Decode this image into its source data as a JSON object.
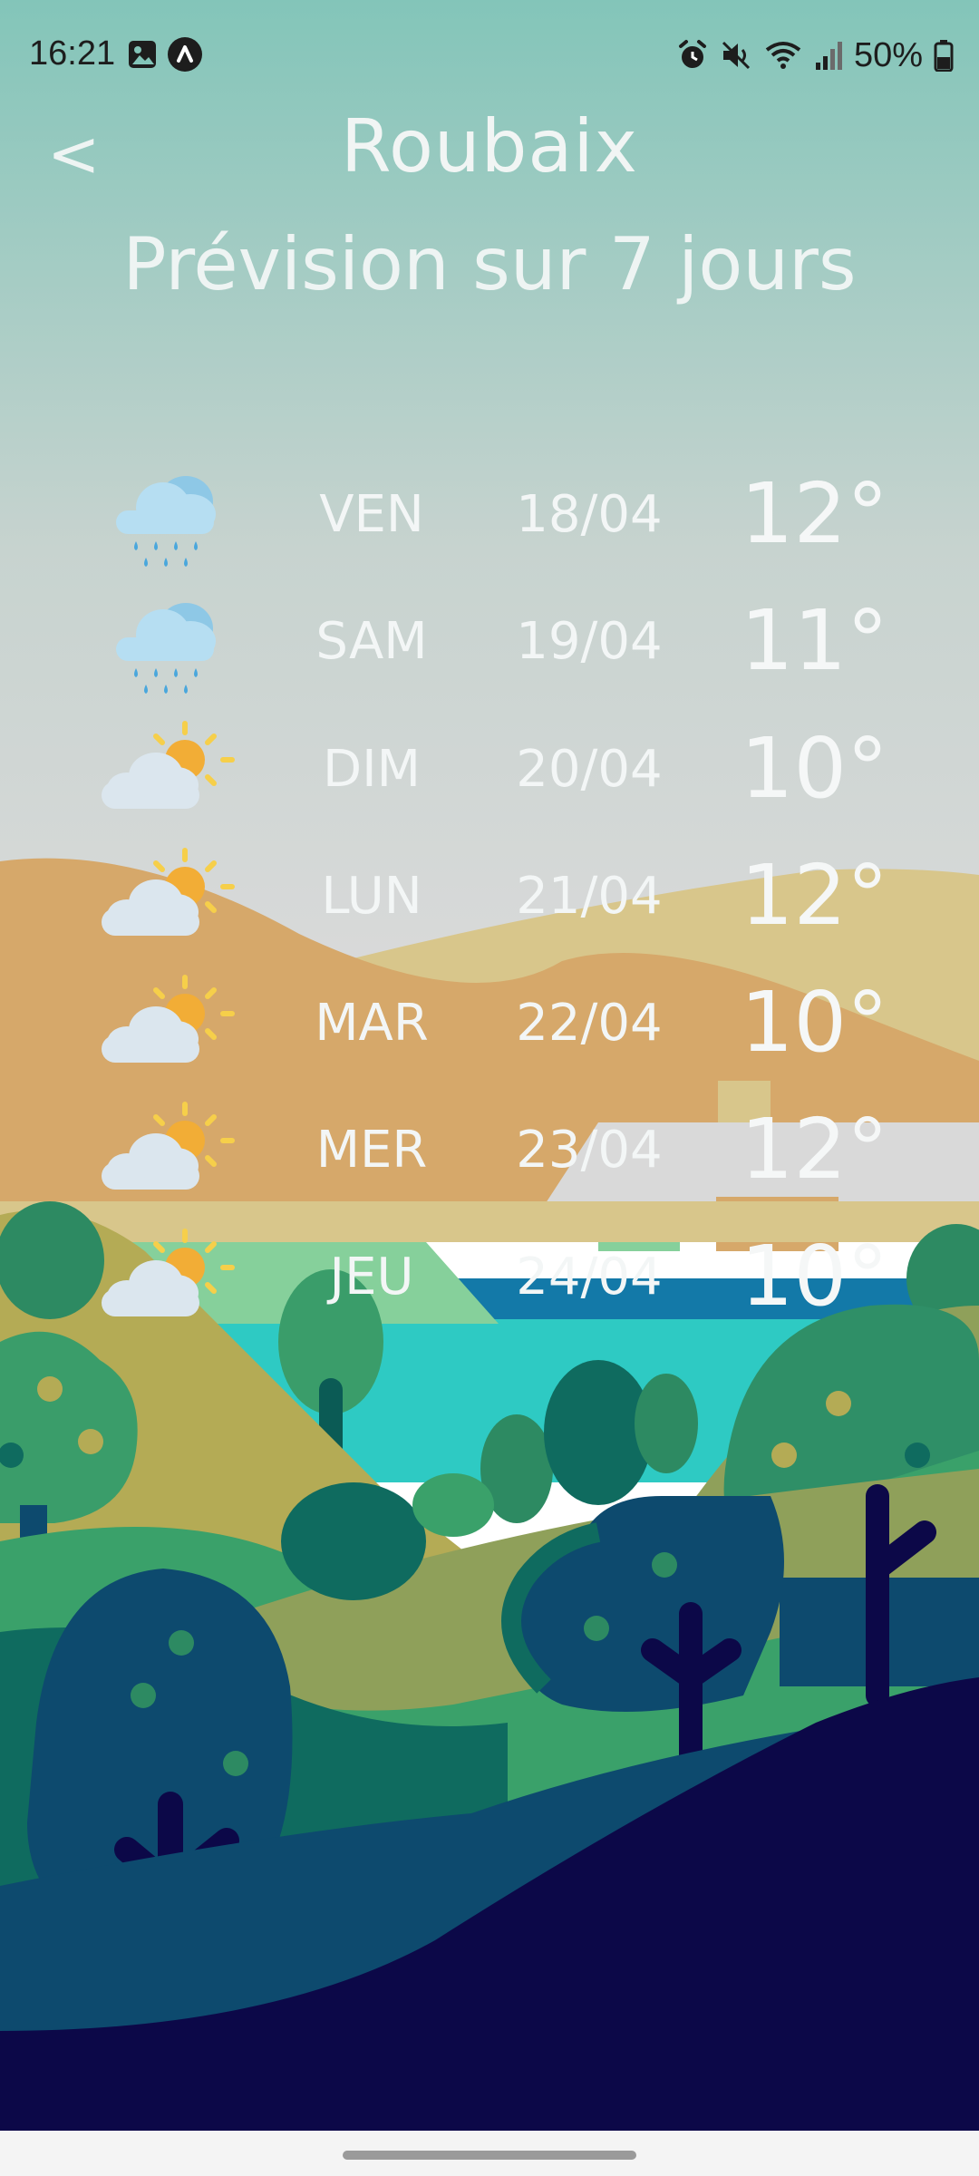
{
  "status_bar": {
    "time": "16:21",
    "battery": "50%",
    "left_icons": [
      "image-icon",
      "nav-arrow-icon"
    ],
    "right_icons": [
      "alarm-icon",
      "mute-icon",
      "wifi-icon",
      "signal-icon",
      "battery-icon"
    ]
  },
  "header": {
    "back_label": "<",
    "city": "Roubaix",
    "subtitle": "Prévision sur 7 jours"
  },
  "forecast": [
    {
      "icon": "rain-cloud-icon",
      "day": "VEN",
      "date": "18/04",
      "temp": "12°"
    },
    {
      "icon": "rain-cloud-icon",
      "day": "SAM",
      "date": "19/04",
      "temp": "11°"
    },
    {
      "icon": "partly-sunny-icon",
      "day": "DIM",
      "date": "20/04",
      "temp": "10°"
    },
    {
      "icon": "partly-sunny-icon",
      "day": "LUN",
      "date": "21/04",
      "temp": "12°"
    },
    {
      "icon": "partly-sunny-icon",
      "day": "MAR",
      "date": "22/04",
      "temp": "10°"
    },
    {
      "icon": "partly-sunny-icon",
      "day": "MER",
      "date": "23/04",
      "temp": "12°"
    },
    {
      "icon": "partly-sunny-icon",
      "day": "JEU",
      "date": "24/04",
      "temp": "10°"
    }
  ],
  "colors": {
    "sky_top": "#83c5b9",
    "sky_bottom": "#d8d8d8",
    "hill_orange": "#d6a86a",
    "hill_tan": "#d8c68b",
    "lake": "#2ecac3",
    "deep_navy": "#0c0848",
    "text": "#f3f6f6"
  }
}
